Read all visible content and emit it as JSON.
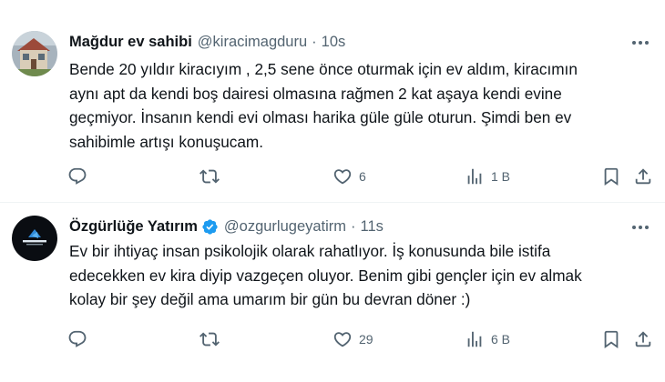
{
  "tweets": [
    {
      "name": "Mağdur ev sahibi",
      "handle": "@kiracimagduru",
      "separator": "·",
      "time": "10s",
      "text": "Bende 20 yıldır kiracıyım , 2,5 sene önce oturmak için ev aldım, kiracımın\naynı apt da kendi boş dairesi olmasına rağmen 2 kat aşaya kendi evine\ngeçmiyor. İnsanın kendi evi olması harika güle güle oturun. Şimdi ben ev\nsahibimle artışı konuşucam.",
      "verified": false,
      "replies": "",
      "retweets": "",
      "likes": "6",
      "views": "1 B"
    },
    {
      "name": "Özgürlüğe Yatırım",
      "handle": "@ozgurlugeyatirm",
      "separator": "·",
      "time": "11s",
      "text": "Ev bir ihtiyaç insan psikolojik olarak rahatlıyor. İş konusunda bile istifa\nedecekken ev kira diyip vazgeçen oluyor. Benim gibi gençler için ev almak\nkolay bir şey değil ama umarım bir gün bu devran döner :)",
      "verified": true,
      "avatar_text": "ÖZGÜRLÜĞE YATIRIM",
      "replies": "",
      "retweets": "",
      "likes": "29",
      "views": "6 B"
    }
  ],
  "colors": {
    "text": "#0f1419",
    "muted": "#536471",
    "verified": "#1d9bf0",
    "divider": "#eff3f4"
  },
  "icons": [
    "reply-icon",
    "retweet-icon",
    "like-icon",
    "views-icon",
    "bookmark-icon",
    "share-icon",
    "more-icon",
    "verified-badge-icon"
  ]
}
